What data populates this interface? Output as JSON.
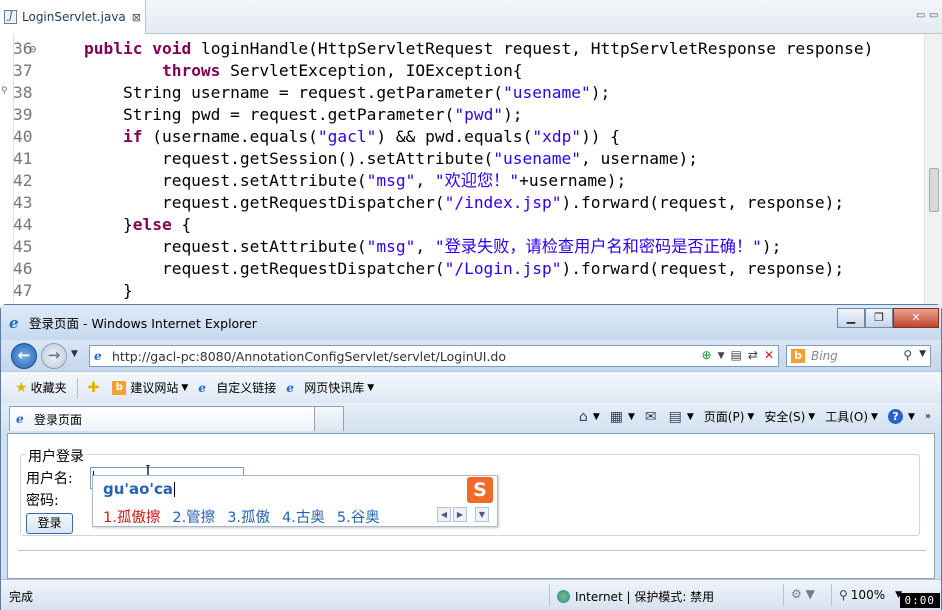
{
  "editor": {
    "tab_label": "LoginServlet.java",
    "tab_close": "⊠",
    "minimize": "▭",
    "maximize": "▭"
  },
  "code_lines": [
    {
      "n": "36",
      "fold": "⊖",
      "parts": [
        [
          "",
          "    "
        ],
        [
          "kw",
          "public"
        ],
        [
          "",
          " "
        ],
        [
          "kw",
          "void"
        ],
        [
          "",
          " loginHandle(HttpServletRequest request, HttpServletResponse response)"
        ]
      ]
    },
    {
      "n": "37",
      "fold": "",
      "parts": [
        [
          "",
          "            "
        ],
        [
          "kw",
          "throws"
        ],
        [
          "",
          " ServletException, IOException{"
        ]
      ]
    },
    {
      "n": "38",
      "fold": "",
      "parts": [
        [
          "",
          "        String username = request.getParameter("
        ],
        [
          "str",
          "\"usename\""
        ],
        [
          "",
          ");"
        ]
      ]
    },
    {
      "n": "39",
      "fold": "",
      "parts": [
        [
          "",
          "        String pwd = request.getParameter("
        ],
        [
          "str",
          "\"pwd\""
        ],
        [
          "",
          ");"
        ]
      ]
    },
    {
      "n": "40",
      "fold": "",
      "parts": [
        [
          "",
          "        "
        ],
        [
          "kw",
          "if"
        ],
        [
          "",
          " (username.equals("
        ],
        [
          "str",
          "\"gacl\""
        ],
        [
          "",
          ") && pwd.equals("
        ],
        [
          "str",
          "\"xdp\""
        ],
        [
          "",
          ")) {"
        ]
      ]
    },
    {
      "n": "41",
      "fold": "",
      "parts": [
        [
          "",
          "            request.getSession().setAttribute("
        ],
        [
          "str",
          "\"usename\""
        ],
        [
          "",
          ", username);"
        ]
      ]
    },
    {
      "n": "42",
      "fold": "",
      "parts": [
        [
          "",
          "            request.setAttribute("
        ],
        [
          "str",
          "\"msg\""
        ],
        [
          "",
          ", "
        ],
        [
          "str",
          "\"欢迎您！\""
        ],
        [
          "",
          "+username);"
        ]
      ]
    },
    {
      "n": "43",
      "fold": "",
      "parts": [
        [
          "",
          "            request.getRequestDispatcher("
        ],
        [
          "str",
          "\"/index.jsp\""
        ],
        [
          "",
          ").forward(request, response);"
        ]
      ]
    },
    {
      "n": "44",
      "fold": "",
      "parts": [
        [
          "",
          "        }"
        ],
        [
          "kw",
          "else"
        ],
        [
          "",
          " {"
        ]
      ]
    },
    {
      "n": "45",
      "fold": "",
      "parts": [
        [
          "",
          "            request.setAttribute("
        ],
        [
          "str",
          "\"msg\""
        ],
        [
          "",
          ", "
        ],
        [
          "str",
          "\"登录失败，请检查用户名和密码是否正确！\""
        ],
        [
          "",
          ");"
        ]
      ]
    },
    {
      "n": "46",
      "fold": "",
      "parts": [
        [
          "",
          "            request.getRequestDispatcher("
        ],
        [
          "str",
          "\"/Login.jsp\""
        ],
        [
          "",
          ").forward(request, response);"
        ]
      ]
    },
    {
      "n": "47",
      "fold": "",
      "parts": [
        [
          "",
          "        }"
        ]
      ]
    }
  ],
  "ie": {
    "window_title": "登录页面 - Windows Internet Explorer",
    "address": "http://gacl-pc:8080/AnnotationConfigServlet/servlet/LoginUI.do",
    "search_placeholder": "Bing",
    "favorites_label": "收藏夹",
    "fav_links": [
      "建议网站",
      "自定义链接",
      "网页快讯库"
    ],
    "tab_title": "登录页面",
    "commands": {
      "page": "页面(P)",
      "safety": "安全(S)",
      "tools": "工具(O)"
    },
    "status": "完成",
    "zone": "Internet | 保护模式: 禁用",
    "zoom": "100%"
  },
  "form": {
    "legend": "用户登录",
    "username_label": "用户名:",
    "password_label": "密码:",
    "submit": "登录"
  },
  "ime": {
    "composition": "gu'ao'ca",
    "candidates": [
      "1.孤傲擦",
      "2.管擦",
      "3.孤傲",
      "4.古奥",
      "5.谷奥"
    ],
    "logo": "S"
  },
  "recorder": {
    "time": "0:00"
  },
  "colors": {
    "keyword": "#7f0055",
    "string": "#2a00ff",
    "ime_text": "#2463b3",
    "ime_first": "#d01717",
    "ime_logo": "#f06a2a"
  }
}
